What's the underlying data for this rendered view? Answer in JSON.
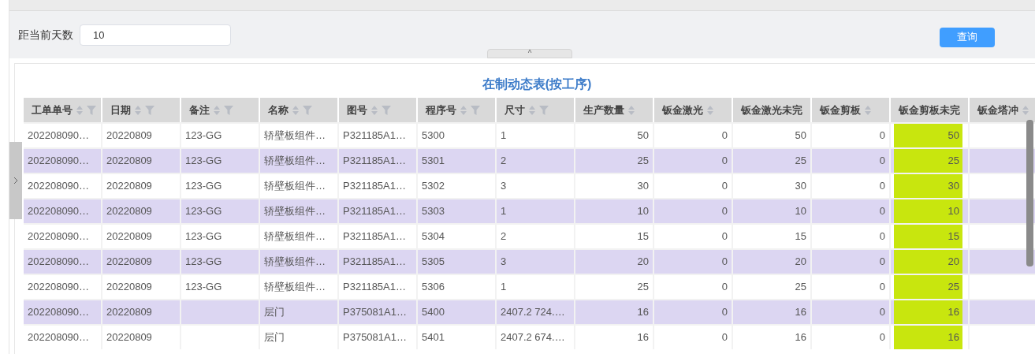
{
  "filter": {
    "label": "距当前天数",
    "value": "10",
    "button": "查询",
    "collapse_icon": "^"
  },
  "table": {
    "title": "在制动态表(按工序)",
    "columns": [
      {
        "label": "工单单号",
        "kind": "text",
        "sortable": true,
        "filterable": true
      },
      {
        "label": "日期",
        "kind": "text",
        "sortable": true,
        "filterable": true
      },
      {
        "label": "备注",
        "kind": "text",
        "sortable": true,
        "filterable": true
      },
      {
        "label": "名称",
        "kind": "text",
        "sortable": true,
        "filterable": true
      },
      {
        "label": "图号",
        "kind": "text",
        "sortable": true,
        "filterable": true
      },
      {
        "label": "程序号",
        "kind": "text",
        "sortable": true,
        "filterable": true
      },
      {
        "label": "尺寸",
        "kind": "text",
        "sortable": true,
        "filterable": true
      },
      {
        "label": "生产数量",
        "kind": "number",
        "sortable": true,
        "filterable": false
      },
      {
        "label": "钣金激光",
        "kind": "number",
        "sortable": true,
        "filterable": false
      },
      {
        "label": "钣金激光未完",
        "kind": "number",
        "sortable": false,
        "filterable": false
      },
      {
        "label": "钣金剪板",
        "kind": "number",
        "sortable": true,
        "filterable": false
      },
      {
        "label": "钣金剪板未完",
        "kind": "number",
        "sortable": false,
        "filterable": false,
        "color": "#c8e60e"
      },
      {
        "label": "钣金塔冲",
        "kind": "number",
        "sortable": true,
        "filterable": false
      }
    ],
    "rows": [
      [
        "202208090…",
        "20220809",
        "123-GG",
        "轿壁板组件…",
        "P321185A1…",
        "5300",
        "1",
        "50",
        "0",
        "50",
        "0",
        "50",
        ""
      ],
      [
        "202208090…",
        "20220809",
        "123-GG",
        "轿壁板组件…",
        "P321185A1…",
        "5301",
        "2",
        "25",
        "0",
        "25",
        "0",
        "25",
        ""
      ],
      [
        "202208090…",
        "20220809",
        "123-GG",
        "轿壁板组件…",
        "P321185A1…",
        "5302",
        "3",
        "30",
        "0",
        "30",
        "0",
        "30",
        ""
      ],
      [
        "202208090…",
        "20220809",
        "123-GG",
        "轿壁板组件…",
        "P321185A1…",
        "5303",
        "1",
        "10",
        "0",
        "10",
        "0",
        "10",
        ""
      ],
      [
        "202208090…",
        "20220809",
        "123-GG",
        "轿壁板组件…",
        "P321185A1…",
        "5304",
        "2",
        "15",
        "0",
        "15",
        "0",
        "15",
        ""
      ],
      [
        "202208090…",
        "20220809",
        "123-GG",
        "轿壁板组件…",
        "P321185A1…",
        "5305",
        "3",
        "20",
        "0",
        "20",
        "0",
        "20",
        ""
      ],
      [
        "202208090…",
        "20220809",
        "123-GG",
        "轿壁板组件…",
        "P321185A1…",
        "5306",
        "1",
        "25",
        "0",
        "25",
        "0",
        "25",
        ""
      ],
      [
        "202208090…",
        "20220809",
        "",
        "层门",
        "P375081A1…",
        "5400",
        "2407.2 724.…",
        "16",
        "0",
        "16",
        "0",
        "16",
        ""
      ],
      [
        "202208090…",
        "20220809",
        "",
        "层门",
        "P375081A1…",
        "5401",
        "2407.2 674.…",
        "16",
        "0",
        "16",
        "0",
        "16",
        ""
      ]
    ]
  }
}
